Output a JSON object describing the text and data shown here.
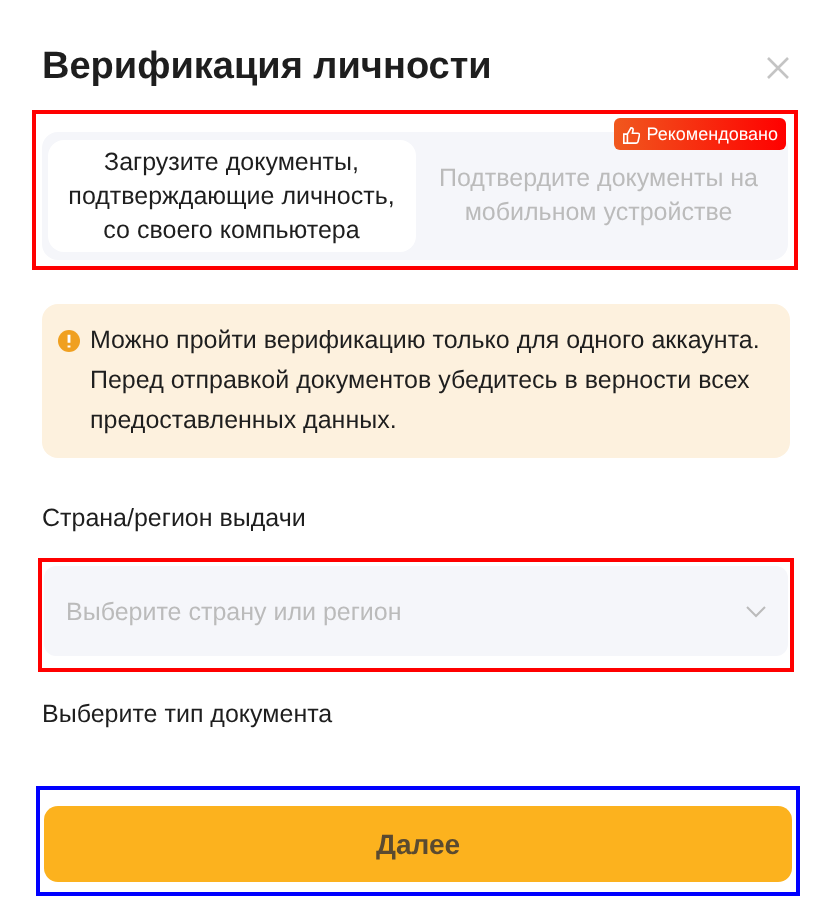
{
  "dialog": {
    "title": "Верификация личности"
  },
  "upload_methods": {
    "highlighted": true,
    "badge": "Рекомендовано",
    "tabs": [
      {
        "label": "Загрузите документы, подтверждающие личность, со своего компьютера",
        "selected": true
      },
      {
        "label": "Подтвердите документы на мобильном устройстве",
        "selected": false
      }
    ]
  },
  "notice": {
    "text": "Можно пройти верификацию только для одного аккаунта. Перед отправкой документов убедитесь в верности всех предоставленных данных."
  },
  "country_field": {
    "label": "Страна/регион выдачи",
    "placeholder": "Выберите страну или регион",
    "highlighted": true
  },
  "document_type": {
    "label": "Выберите тип документа"
  },
  "next_button": {
    "label": "Далее",
    "highlighted": true
  }
}
